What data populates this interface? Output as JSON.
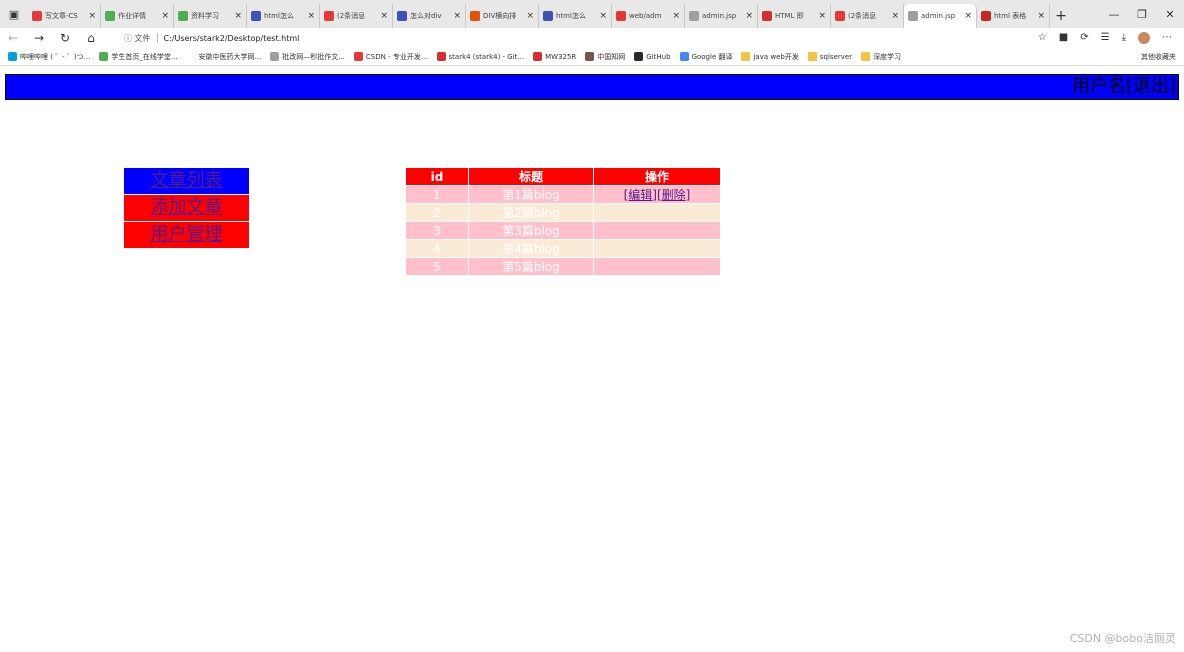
{
  "browser": {
    "tabs": [
      {
        "title": "写文章-CS",
        "fav": "csdn-icon",
        "color": "#e53935"
      },
      {
        "title": "作业详情",
        "fav": "edu-icon",
        "color": "#4caf50"
      },
      {
        "title": "资料学习",
        "fav": "edu-icon",
        "color": "#4caf50"
      },
      {
        "title": "html怎么",
        "fav": "baidu-icon",
        "color": "#3f51b5"
      },
      {
        "title": "(2条消息",
        "fav": "csdn-icon",
        "color": "#e53935"
      },
      {
        "title": "怎么对div",
        "fav": "baidu-icon",
        "color": "#3f51b5"
      },
      {
        "title": "DIV横向排",
        "fav": "html5-icon",
        "color": "#e65100"
      },
      {
        "title": "html怎么",
        "fav": "baidu-icon",
        "color": "#3f51b5"
      },
      {
        "title": "web/adm",
        "fav": "globe-icon",
        "color": "#e53935"
      },
      {
        "title": "admin.jsp",
        "fav": "file-icon",
        "color": "#9e9e9e"
      },
      {
        "title": "HTML 即",
        "fav": "runoob-icon",
        "color": "#d32f2f"
      },
      {
        "title": "(2条消息",
        "fav": "csdn-icon",
        "color": "#e53935"
      },
      {
        "title": "admin.jsp",
        "fav": "file-icon",
        "color": "#9e9e9e",
        "active": true
      },
      {
        "title": "html 表格",
        "fav": "runoob-icon",
        "color": "#c62828"
      }
    ],
    "address": {
      "info_label": "ⓘ 文件",
      "url": "C:/Users/stark2/Desktop/test.html"
    },
    "bookmarks": [
      {
        "label": "哔哩哔哩 ( ゜- ゜)つ...",
        "color": "#00a1d6"
      },
      {
        "label": "学生首页_在线学堂...",
        "color": "#4caf50"
      },
      {
        "label": "安徽中医药大学网...",
        "color": "#ffffff"
      },
      {
        "label": "批改网—秒批作文...",
        "color": "#9e9e9e"
      },
      {
        "label": "CSDN - 专业开发...",
        "color": "#e53935"
      },
      {
        "label": "stark4 (stark4) - Git...",
        "color": "#d32f2f"
      },
      {
        "label": "MW325R",
        "color": "#d32f2f"
      },
      {
        "label": "中国知网",
        "color": "#795548"
      },
      {
        "label": "GitHub",
        "color": "#24292e"
      },
      {
        "label": "Google 翻译",
        "color": "#4285f4"
      },
      {
        "label": "java web开发",
        "folder": true
      },
      {
        "label": "sqlserver",
        "folder": true
      },
      {
        "label": "深度学习",
        "folder": true
      }
    ],
    "other_bookmarks": "其他收藏夹"
  },
  "header": {
    "user_text": "用户名[退出]"
  },
  "sidenav": [
    {
      "label": "文章列表"
    },
    {
      "label": "添加文章"
    },
    {
      "label": "用户管理"
    }
  ],
  "table": {
    "columns": [
      "id",
      "标题",
      "操作"
    ],
    "rows": [
      {
        "id": "1",
        "title": "第1篇blog",
        "edit": "[编辑]",
        "delete": "[删除]"
      },
      {
        "id": "2",
        "title": "第2篇blog"
      },
      {
        "id": "3",
        "title": "第3篇blog"
      },
      {
        "id": "4",
        "title": "第4篇blog"
      },
      {
        "id": "5",
        "title": "第5篇blog"
      }
    ]
  },
  "watermark": "CSDN @bobo洁厕灵",
  "colors": {
    "header_bg": "#0000ff",
    "nav_active_bg": "#0000ff",
    "nav_bg": "#ff0000",
    "table_header_bg": "#ff0000",
    "row_odd_bg": "#ffc0cb",
    "row_even_bg": "#faebd7",
    "link": "#551a8b"
  }
}
